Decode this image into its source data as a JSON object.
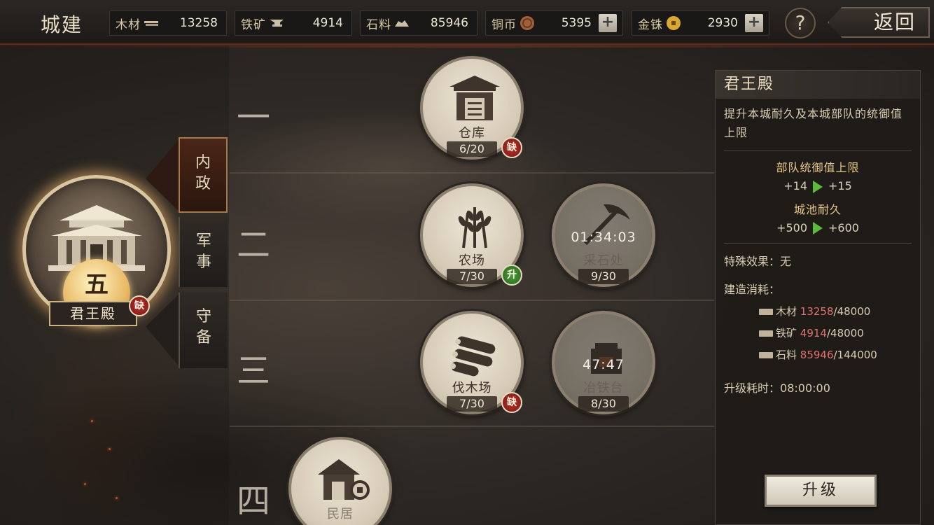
{
  "header": {
    "title": "城建",
    "resources": [
      {
        "name": "木材",
        "icon": "wood-icon",
        "value": "13258"
      },
      {
        "name": "铁矿",
        "icon": "anvil-icon",
        "value": "4914"
      },
      {
        "name": "石料",
        "icon": "stone-icon",
        "value": "85946"
      },
      {
        "name": "铜币",
        "icon": "copper-coin-icon",
        "value": "5395"
      },
      {
        "name": "金铢",
        "icon": "gold-coin-icon",
        "value": "2930"
      }
    ],
    "plus": "+",
    "help": "?",
    "back": "返回"
  },
  "main_building": {
    "level": "五",
    "name": "君王殿",
    "lack_badge": "缺"
  },
  "tabs": [
    {
      "line1": "内",
      "line2": "政"
    },
    {
      "line1": "军",
      "line2": "事"
    },
    {
      "line1": "守",
      "line2": "备"
    }
  ],
  "tiers": [
    "一",
    "二",
    "三",
    "四"
  ],
  "buildings": [
    {
      "name": "仓库",
      "level": "6/20",
      "badge": "缺"
    },
    {
      "name": "农场",
      "level": "7/30",
      "badge": "升"
    },
    {
      "name": "采石处",
      "level": "9/30",
      "timer": "01:34:03"
    },
    {
      "name": "伐木场",
      "level": "7/30",
      "badge": "缺"
    },
    {
      "name": "冶铁台",
      "level": "8/30",
      "timer": "47:47"
    },
    {
      "name": "民居"
    }
  ],
  "panel": {
    "title": "君王殿",
    "description": "提升本城耐久及本城部队的统御值上限",
    "stats": [
      {
        "label": "部队统御值上限",
        "from": "+14",
        "to": "+15"
      },
      {
        "label": "城池耐久",
        "from": "+500",
        "to": "+600"
      }
    ],
    "special_label": "特殊效果：",
    "special_value": "无",
    "cost_label": "建造消耗：",
    "costs": [
      {
        "name": "木材",
        "have": "13258",
        "need": "/48000"
      },
      {
        "name": "铁矿",
        "have": "4914",
        "need": "/48000"
      },
      {
        "name": "石料",
        "have": "85946",
        "need": "/144000"
      }
    ],
    "time_label": "升级耗时：",
    "time_value": "08:00:00",
    "upgrade_button": "升级"
  }
}
